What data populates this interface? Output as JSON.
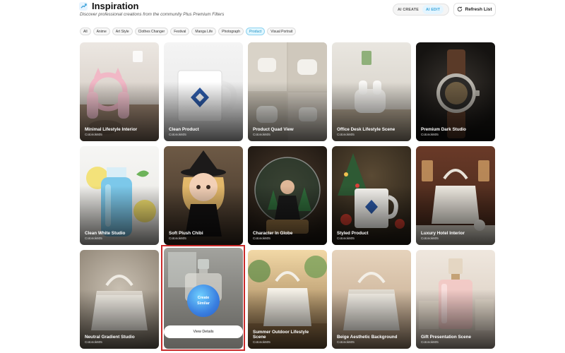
{
  "header": {
    "title": "Inspiration",
    "subtitle": "Discover professional creations from the community Plus Premium Filters",
    "modes": [
      "AI CREATE",
      "AI EDIT"
    ],
    "active_mode": "AI EDIT",
    "refresh_label": "Refresh List"
  },
  "filters": {
    "items": [
      "All",
      "Anime",
      "Art Style",
      "Clothes Changer",
      "Festival",
      "Manga Life",
      "Photograph",
      "Product",
      "Visual Portrait"
    ],
    "active": "Product"
  },
  "cards": [
    {
      "title": "Minimal Lifestyle Interior",
      "author": "Cotonok605"
    },
    {
      "title": "Clean Product",
      "author": "Cotonok605"
    },
    {
      "title": "Product Quad View",
      "author": "Cotonok605"
    },
    {
      "title": "Office Desk Lifestyle Scene",
      "author": "Cotonok605"
    },
    {
      "title": "Premium Dark Studio",
      "author": "Cotonok605"
    },
    {
      "title": "Clean White Studio",
      "author": "Cotonok605"
    },
    {
      "title": "Soft Plush Chibi",
      "author": "Cotonok605"
    },
    {
      "title": "Character In Globe",
      "author": "Cotonok605"
    },
    {
      "title": "Styled Product",
      "author": "Cotonok605"
    },
    {
      "title": "Luxury Hotel Interior",
      "author": "Cotonok605"
    },
    {
      "title": "Neutral Gradient Studio",
      "author": "Cotonok605"
    },
    {
      "title": "",
      "author": ""
    },
    {
      "title": "Summer Outdoor Lifestyle Scene",
      "author": "Cotonok605"
    },
    {
      "title": "Beige Aesthetic Background",
      "author": "Cotonok605"
    },
    {
      "title": "Gift Presentation Scene",
      "author": "Cotonok605"
    }
  ],
  "hover_card": {
    "create_similar_label": [
      "Create",
      "Similar"
    ],
    "view_details_label": "View Details"
  },
  "colors": {
    "accent": "#36a3d9",
    "active_chip_bg": "#dff6ff",
    "highlight_border": "#c92a2a"
  }
}
